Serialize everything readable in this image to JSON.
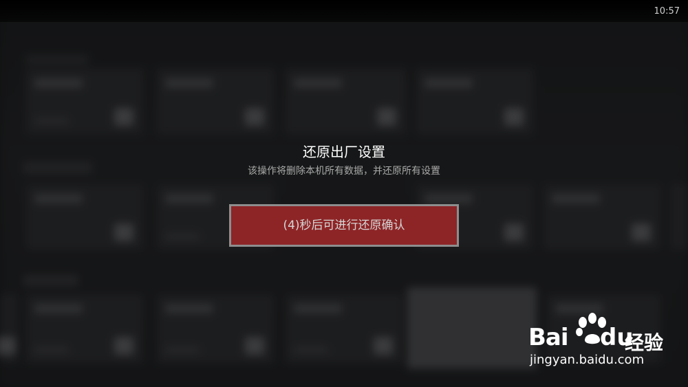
{
  "status_bar": {
    "time": "10:57"
  },
  "dialog": {
    "title": "还原出厂设置",
    "subtitle": "该操作将删除本机所有数据，并还原所有设置",
    "confirm_button_label": "(4)秒后可进行还原确认"
  },
  "watermark": {
    "brand_bai": "Bai",
    "brand_du": "du",
    "brand_jingyan": "经验",
    "url": "jingyan.baidu.com"
  },
  "colors": {
    "button_fill": "#8d2527",
    "button_border": "#8e8e8e",
    "background": "#1b1c1e"
  }
}
